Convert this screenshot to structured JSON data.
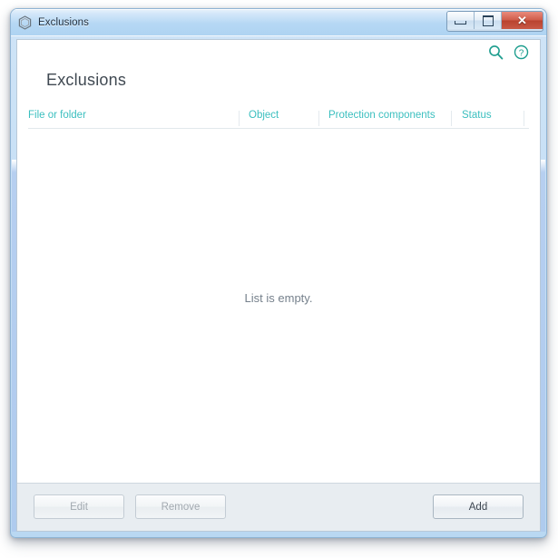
{
  "window": {
    "title": "Exclusions",
    "app_icon": "shield-hexagon-icon",
    "controls": {
      "minimize": "minimize-icon",
      "maximize": "maximize-icon",
      "close": "✕",
      "close_label": "Close"
    }
  },
  "toolbar": {
    "search_icon": "search-icon",
    "help_icon": "help-icon"
  },
  "main": {
    "heading": "Exclusions",
    "empty_message": "List is empty.",
    "columns": [
      {
        "label": "File or folder"
      },
      {
        "label": "Object"
      },
      {
        "label": "Protection components"
      },
      {
        "label": "Status"
      }
    ],
    "rows": []
  },
  "footer": {
    "edit_label": "Edit",
    "remove_label": "Remove",
    "add_label": "Add"
  },
  "colors": {
    "accent_teal": "#3bbfbf",
    "titlebar_blue": "#b6d8f4",
    "close_red": "#c04c38",
    "heading_gray": "#404952",
    "empty_text_gray": "#76818c",
    "footer_bg": "#e8edf1"
  }
}
